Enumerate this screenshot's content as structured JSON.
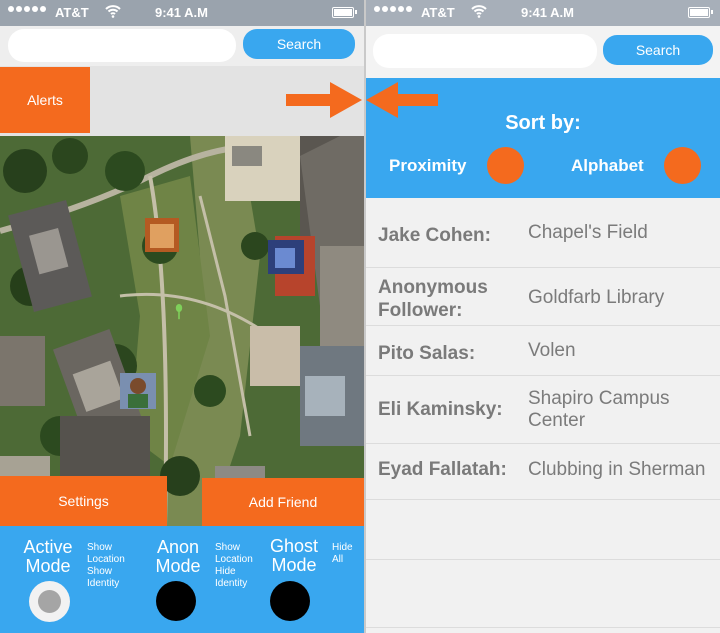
{
  "status_bar": {
    "carrier": "AT&T",
    "time": "9:41 A.M"
  },
  "left_screen": {
    "search": {
      "value": "",
      "placeholder": "",
      "button_label": "Search"
    },
    "alerts_label": "Alerts",
    "settings_label": "Settings",
    "add_friend_label": "Add Friend",
    "modes": [
      {
        "title_line1": "Active",
        "title_line2": "Mode",
        "desc": [
          "Show",
          "Location",
          "Show",
          "Identity"
        ],
        "state": "selected"
      },
      {
        "title_line1": "Anon",
        "title_line2": "Mode",
        "desc": [
          "Show",
          "Location",
          "Hide",
          "Identity"
        ],
        "state": "off"
      },
      {
        "title_line1": "Ghost",
        "title_line2": "Mode",
        "desc": [
          "Hide",
          "All"
        ],
        "state": "off"
      }
    ]
  },
  "right_screen": {
    "search": {
      "value": "",
      "placeholder": "",
      "button_label": "Search"
    },
    "sort": {
      "title": "Sort by:",
      "options": [
        "Proximity",
        "Alphabet"
      ]
    },
    "people": [
      {
        "name_lines": [
          "Jake Cohen:"
        ],
        "place_lines": [
          "Chapel's Field"
        ]
      },
      {
        "name_lines": [
          "Anonymous",
          "Follower:"
        ],
        "place_lines": [
          "Goldfarb Library"
        ]
      },
      {
        "name_lines": [
          "Pito Salas:"
        ],
        "place_lines": [
          "Volen"
        ]
      },
      {
        "name_lines": [
          "Eli Kaminsky:"
        ],
        "place_lines": [
          "Shapiro Campus",
          "Center"
        ]
      },
      {
        "name_lines": [
          "Eyad Fallatah:"
        ],
        "place_lines": [
          "Clubbing in Sherman"
        ]
      }
    ]
  },
  "icons": [
    "wifi-icon",
    "battery-icon",
    "signal-dots-icon",
    "arrow-right-icon",
    "arrow-left-icon",
    "map-pin-icon"
  ],
  "colors": {
    "accent_blue": "#39a7ef",
    "accent_orange": "#f46a1e",
    "status_bar": "#9aa3ad"
  }
}
